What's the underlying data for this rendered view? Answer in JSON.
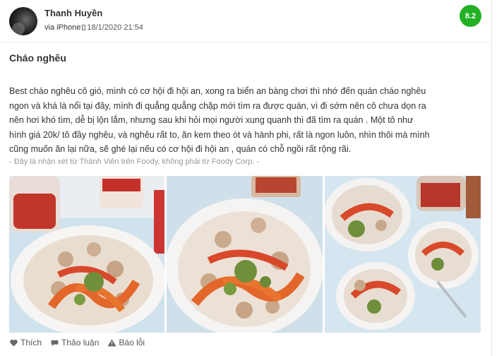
{
  "review": {
    "author": "Thanh Huyền",
    "via": "via iPhone",
    "device_icon": "phone-icon",
    "date": "18/1/2020 21:54",
    "score": "8.2",
    "score_color": "#22b024",
    "title": "Cháo nghêu",
    "body_lines": [
      "Best cháo nghêu cô gió, mình có cơ hội đi hội an, xong ra biển an bàng chơi thì nhớ đến quán cháo nghêu",
      "ngon và khá là nổi tại đây, mình đi quẳng quẳng chặp mới tìm ra được quán, vì đi sớm nên cô chưa dọn ra",
      "nên hơi khó tìm, dễ bị lộn lắm, nhưng sau khi hỏi mọi người xung quanh thì đã tìm ra quán . Một tô như",
      "hình giá 20k/ tô đầy nghêu, và nghêu rất to, ăn kem theo ót và hành phi, rất là ngon luôn, nhìn thôi mà mình",
      "cũng muốn ăn lại nữa, sẽ ghé lại nếu có cơ hội đi hội an , quán có chỗ ngồi rất rộng rãi."
    ],
    "disclaimer": "- Đây là nhận xét từ Thành Viên trên Foody, không phải từ Foody Corp. -"
  },
  "photos": [
    {
      "name": "photo-1"
    },
    {
      "name": "photo-2"
    },
    {
      "name": "photo-3"
    }
  ],
  "actions": {
    "like": "Thích",
    "like_icon": "heart-icon",
    "discuss": "Thảo luận",
    "discuss_icon": "comment-icon",
    "report": "Báo lỗi",
    "report_icon": "warning-icon"
  }
}
